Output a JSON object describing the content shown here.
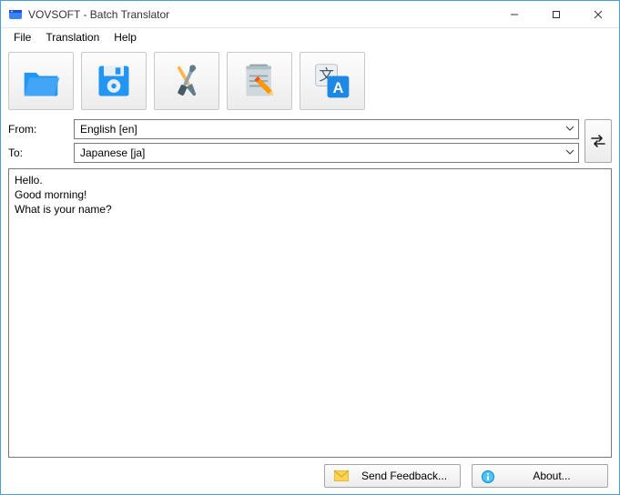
{
  "titlebar": {
    "title": "VOVSOFT - Batch Translator"
  },
  "menubar": {
    "items": [
      "File",
      "Translation",
      "Help"
    ]
  },
  "toolbar": {
    "buttons": [
      "open",
      "save",
      "settings",
      "edit",
      "translate"
    ]
  },
  "lang": {
    "from_label": "From:",
    "to_label": "To:",
    "from_value": "English [en]",
    "to_value": "Japanese [ja]"
  },
  "text": {
    "content": "Hello.\nGood morning!\nWhat is your name?"
  },
  "bottom": {
    "feedback_label": "Send Feedback...",
    "about_label": "About..."
  }
}
